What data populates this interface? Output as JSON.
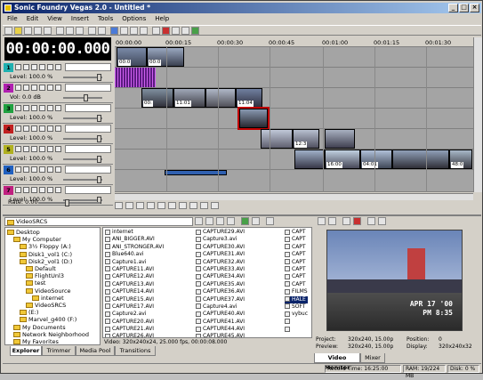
{
  "window": {
    "title": "Sonic Foundry Vegas 2.0 - Untitled *"
  },
  "menu": [
    "File",
    "Edit",
    "View",
    "Insert",
    "Tools",
    "Options",
    "Help"
  ],
  "timecode": "00:00:00.000",
  "ruler": [
    "00:00:00",
    "00:00:15",
    "00:00:30",
    "00:00:45",
    "00:01:00",
    "00:01:15",
    "00:01:30"
  ],
  "tracks": [
    {
      "num": "1",
      "color": "#20b0b0",
      "level_label": "Level:",
      "level_value": "100.0 %",
      "slider": 1.0
    },
    {
      "num": "2",
      "color": "#b020b0",
      "level_label": "Vol:",
      "level_value": "0.0 dB",
      "slider": 0.6
    },
    {
      "num": "3",
      "color": "#20a040",
      "level_label": "Level:",
      "level_value": "100.0 %",
      "slider": 1.0
    },
    {
      "num": "4",
      "color": "#c02020",
      "level_label": "Level:",
      "level_value": "100.0 %",
      "slider": 1.0
    },
    {
      "num": "5",
      "color": "#b0b020",
      "level_label": "Level:",
      "level_value": "100.0 %",
      "slider": 1.0
    },
    {
      "num": "6",
      "color": "#2060c0",
      "level_label": "Level:",
      "level_value": "100.0 %",
      "slider": 1.0
    },
    {
      "num": "7",
      "color": "#c02080",
      "level_label": "Level:",
      "level_value": "100.0 %",
      "slider": 1.0
    }
  ],
  "clip_labels": {
    "t1a": "00:0",
    "t1b": "00:0",
    "t3a": "00:",
    "t3b": "11:01",
    "t3c": "",
    "t3d": "11:04",
    "t4a": "",
    "t5a": "",
    "t5b": "12:3",
    "t5c": "",
    "t6a": "",
    "t6b": "16:00",
    "t6c": "04:01",
    "t6d": "48:0"
  },
  "rate": {
    "label": "Rate: 0.00"
  },
  "explorer": {
    "path": "VideoSRCS",
    "status": "Video: 320x240x24, 25.000 fps, 00:00:08.000"
  },
  "tree": [
    {
      "label": "Desktop",
      "indent": 0
    },
    {
      "label": "My Computer",
      "indent": 1
    },
    {
      "label": "3½ Floppy (A:)",
      "indent": 2
    },
    {
      "label": "Disk1_vol1 (C:)",
      "indent": 2
    },
    {
      "label": "Disk2_vol1 (D:)",
      "indent": 2
    },
    {
      "label": "Default",
      "indent": 3
    },
    {
      "label": "FlightUnl3",
      "indent": 3
    },
    {
      "label": "test",
      "indent": 3
    },
    {
      "label": "VideoSource",
      "indent": 3
    },
    {
      "label": "internet",
      "indent": 4
    },
    {
      "label": "VideoSRCS",
      "indent": 3
    },
    {
      "label": "(E:)",
      "indent": 2
    },
    {
      "label": "Marvel_g400 (F:)",
      "indent": 2
    },
    {
      "label": "My Documents",
      "indent": 1
    },
    {
      "label": "Network Neighborhood",
      "indent": 1
    },
    {
      "label": "My Favorites",
      "indent": 1
    }
  ],
  "files_col1": [
    "internet",
    "ANI_BIGGER.AVI",
    "ANI_STRONGER.AVI",
    "Blue640.avi",
    "Capture1.avi",
    "CAPTURE11.AVI",
    "CAPTURE12.AVI",
    "CAPTURE13.AVI",
    "CAPTURE14.AVI",
    "CAPTURE15.AVI",
    "CAPTURE17.AVI",
    "Capture2.avi",
    "CAPTURE20.AVI",
    "CAPTURE21.AVI",
    "CAPTURE26.AVI"
  ],
  "files_col2": [
    "CAPTURE29.AVI",
    "Capture3.avi",
    "CAPTURE30.AVI",
    "CAPTURE31.AVI",
    "CAPTURE32.AVI",
    "CAPTURE33.AVI",
    "CAPTURE34.AVI",
    "CAPTURE35.AVI",
    "CAPTURE36.AVI",
    "CAPTURE37.AVI",
    "Capture4.avi",
    "CAPTURE40.AVI",
    "CAPTURE41.AVI",
    "CAPTURE44.AVI",
    "CAPTURE45.AVI"
  ],
  "files_col3": [
    "CAPT",
    "CAPT",
    "CAPT",
    "CAPT",
    "CAPT",
    "CAPT",
    "CAPT",
    "CAPT",
    "FILMS",
    "HALE",
    "SOFT",
    "vybuc",
    "",
    ""
  ],
  "tabs": [
    "Explorer",
    "Trimmer",
    "Media Pool",
    "Transitions"
  ],
  "monitor": {
    "stamp_line1": "APR 17 '00",
    "stamp_line2": "PM 8:35",
    "project_label": "Project:",
    "project_value": "320x240, 15.00p",
    "preview_label": "Preview:",
    "preview_value": "320x240, 15.00p",
    "position_label": "Position:",
    "position_value": "0",
    "display_label": "Display:",
    "display_value": "320x240x32",
    "tabs": [
      "Video Monitor",
      "Mixer"
    ]
  },
  "status": {
    "record": "Record Time: 16:25:00",
    "ram": "RAM: 19/224 MB",
    "disk": "Disk: 0 %"
  }
}
